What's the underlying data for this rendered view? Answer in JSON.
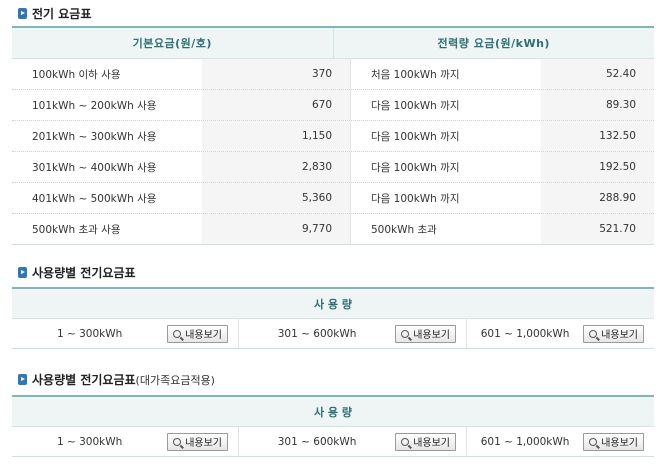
{
  "section1": {
    "title": "전기 요금표",
    "col_headers": [
      "기본요금(원/호)",
      "전력량 요금(원/kWh)"
    ],
    "rows": [
      {
        "basic_label": "100kWh 이하 사용",
        "basic_value": "370",
        "energy_label": "처음 100kWh 까지",
        "energy_value": "52.40"
      },
      {
        "basic_label": "101kWh ~ 200kWh 사용",
        "basic_value": "670",
        "energy_label": "다음 100kWh 까지",
        "energy_value": "89.30"
      },
      {
        "basic_label": "201kWh ~ 300kWh 사용",
        "basic_value": "1,150",
        "energy_label": "다음 100kWh 까지",
        "energy_value": "132.50"
      },
      {
        "basic_label": "301kWh ~ 400kWh 사용",
        "basic_value": "2,830",
        "energy_label": "다음 100kWh 까지",
        "energy_value": "192.50"
      },
      {
        "basic_label": "401kWh ~ 500kWh 사용",
        "basic_value": "5,360",
        "energy_label": "다음 100kWh 까지",
        "energy_value": "288.90"
      },
      {
        "basic_label": "500kWh 초과 사용",
        "basic_value": "9,770",
        "energy_label": "500kWh 초과",
        "energy_value": "521.70"
      }
    ]
  },
  "section2": {
    "title": "사용량별 전기요금표",
    "header": "사 용 량",
    "ranges": [
      {
        "label": "1 ~ 300kWh",
        "button": "내용보기"
      },
      {
        "label": "301 ~ 600kWh",
        "button": "내용보기"
      },
      {
        "label": "601 ~ 1,000kWh",
        "button": "내용보기"
      }
    ]
  },
  "section3": {
    "title": "사용량별 전기요금표",
    "subtitle": "(대가족요금적용)",
    "header": "사 용 량",
    "ranges": [
      {
        "label": "1 ~ 300kWh",
        "button": "내용보기"
      },
      {
        "label": "301 ~ 600kWh",
        "button": "내용보기"
      },
      {
        "label": "601 ~ 1,000kWh",
        "button": "내용보기"
      }
    ]
  },
  "colors": {
    "accent": "#2f78b5",
    "table_border": "#7fb6b8",
    "header_bg": "#eef5f4",
    "header_text": "#2f6f73"
  }
}
